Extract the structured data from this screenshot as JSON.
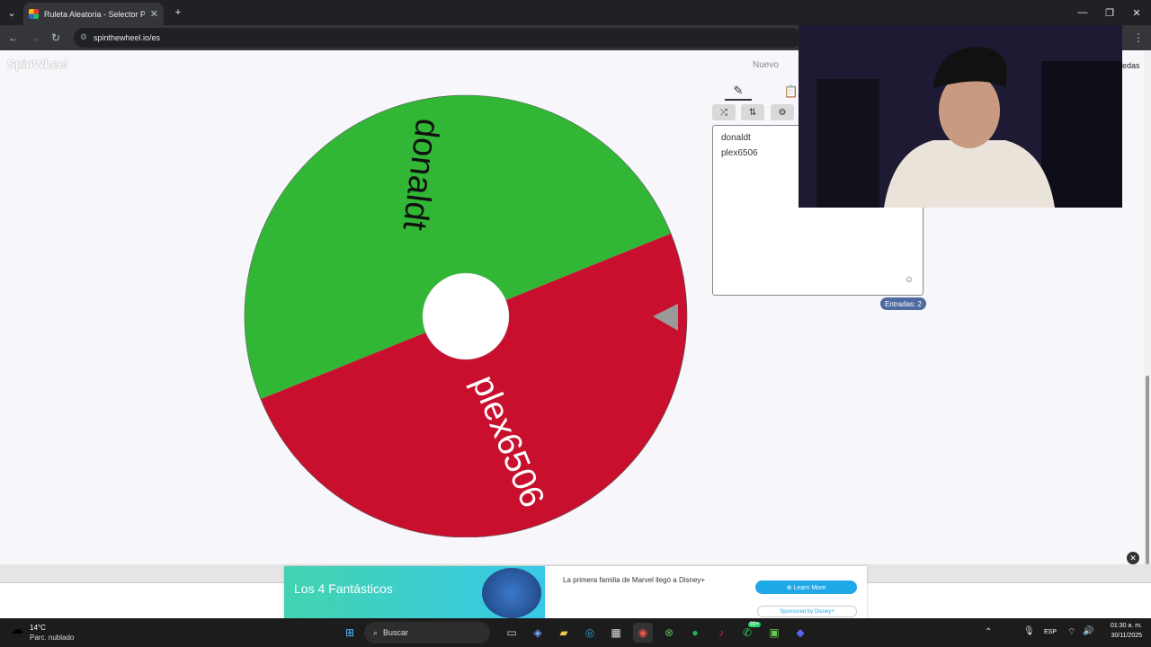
{
  "browser": {
    "tab_title": "Ruleta Aleatoria - Selector Pers",
    "url": "spinthewheel.io/es"
  },
  "site": {
    "logo": "SpinWheel",
    "nav_new": "Nuevo",
    "nav_right_partial": "edas"
  },
  "wheel": {
    "segments": [
      {
        "label": "donaldt",
        "color": "#31b735",
        "text_color": "#111111"
      },
      {
        "label": "plex6506",
        "color": "#c8102e",
        "text_color": "#ffffff"
      }
    ]
  },
  "panel": {
    "entries_lines": [
      "donaldt",
      "plex6506"
    ],
    "count_label": "Entradas: 2"
  },
  "ad": {
    "title": "Los 4 Fantásticos",
    "description": "La primera familia de Marvel llegó a Disney+",
    "cta": "⊕ Learn More",
    "sponsored": "Sponsored by Disney+"
  },
  "taskbar": {
    "weather_temp": "14°C",
    "weather_desc": "Parc. nublado",
    "search_placeholder": "Buscar",
    "lang": "ESP",
    "time": "01:30 a. m.",
    "date": "30/11/2025",
    "whatsapp_badge": "99+"
  }
}
